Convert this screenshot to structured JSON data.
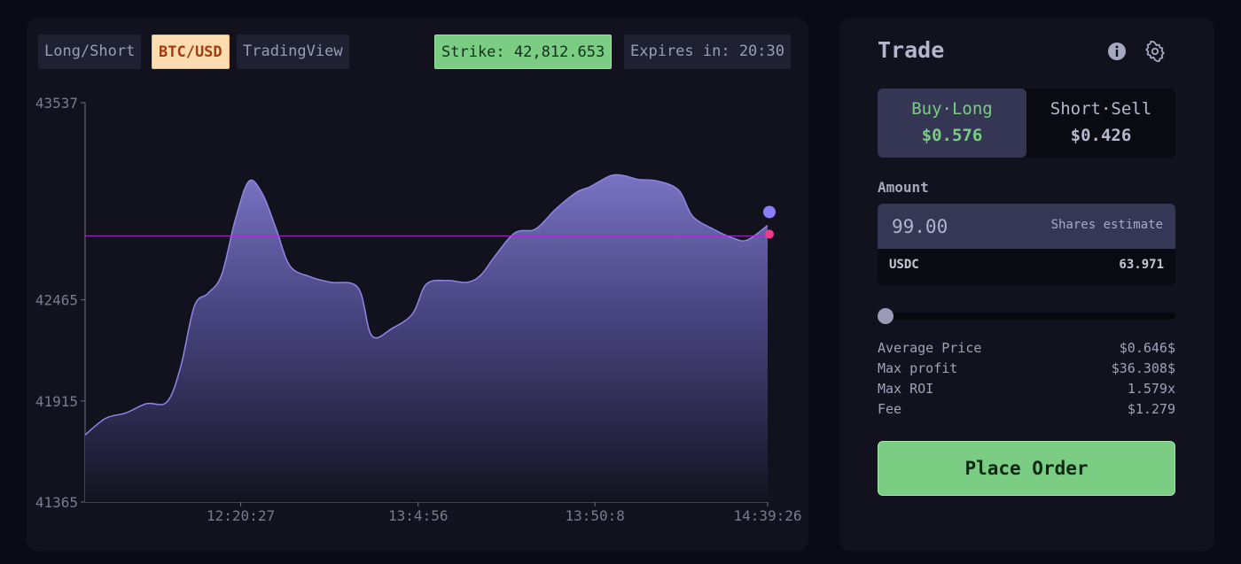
{
  "header": {
    "chips": [
      "Long/Short",
      "BTC/USD",
      "TradingView"
    ],
    "strike": "Strike: 42,812.653",
    "expires": "Expires in: 20:30"
  },
  "chart_data": {
    "type": "area",
    "y_ticks": [
      "43537",
      "42465",
      "41915",
      "41365"
    ],
    "x_ticks": [
      "12:20:27",
      "13:4:56",
      "13:50:8",
      "14:39:26"
    ],
    "ylim": [
      41365,
      43537
    ],
    "strike_line": 42812.653,
    "points": [
      [
        0.0,
        41730
      ],
      [
        0.03,
        41820
      ],
      [
        0.06,
        41850
      ],
      [
        0.09,
        41900
      ],
      [
        0.12,
        41910
      ],
      [
        0.14,
        42100
      ],
      [
        0.16,
        42430
      ],
      [
        0.18,
        42500
      ],
      [
        0.2,
        42600
      ],
      [
        0.22,
        42900
      ],
      [
        0.24,
        43110
      ],
      [
        0.26,
        43040
      ],
      [
        0.28,
        42850
      ],
      [
        0.3,
        42650
      ],
      [
        0.33,
        42590
      ],
      [
        0.36,
        42560
      ],
      [
        0.4,
        42530
      ],
      [
        0.42,
        42270
      ],
      [
        0.45,
        42310
      ],
      [
        0.48,
        42390
      ],
      [
        0.5,
        42550
      ],
      [
        0.53,
        42570
      ],
      [
        0.56,
        42560
      ],
      [
        0.58,
        42600
      ],
      [
        0.6,
        42700
      ],
      [
        0.63,
        42830
      ],
      [
        0.66,
        42850
      ],
      [
        0.69,
        42960
      ],
      [
        0.72,
        43050
      ],
      [
        0.74,
        43080
      ],
      [
        0.77,
        43140
      ],
      [
        0.79,
        43140
      ],
      [
        0.81,
        43120
      ],
      [
        0.84,
        43110
      ],
      [
        0.87,
        43060
      ],
      [
        0.89,
        42920
      ],
      [
        0.92,
        42850
      ],
      [
        0.95,
        42800
      ],
      [
        0.97,
        42790
      ],
      [
        1.0,
        42870
      ]
    ],
    "last_value": 42875,
    "colors": {
      "line": "#8c87e6",
      "strike": "#b025d8",
      "dot_price": "#8a80ff",
      "dot_strike": "#f03a8a"
    }
  },
  "trade": {
    "title": "Trade",
    "buy_label": "Buy·Long",
    "buy_price": "$0.576",
    "sell_label": "Short·Sell",
    "sell_price": "$0.426",
    "amount_label": "Amount",
    "amount_value": "99.00",
    "shares_estimate": "Shares estimate",
    "usdc_label": "USDC",
    "usdc_value": "63.971",
    "slider_value": 0,
    "stats": [
      {
        "label": "Average Price",
        "value": "$0.646$"
      },
      {
        "label": "Max profit",
        "value": "$36.308$"
      },
      {
        "label": "Max ROI",
        "value": "1.579x"
      },
      {
        "label": "Fee",
        "value": "$1.279"
      }
    ],
    "place_order": "Place Order"
  }
}
